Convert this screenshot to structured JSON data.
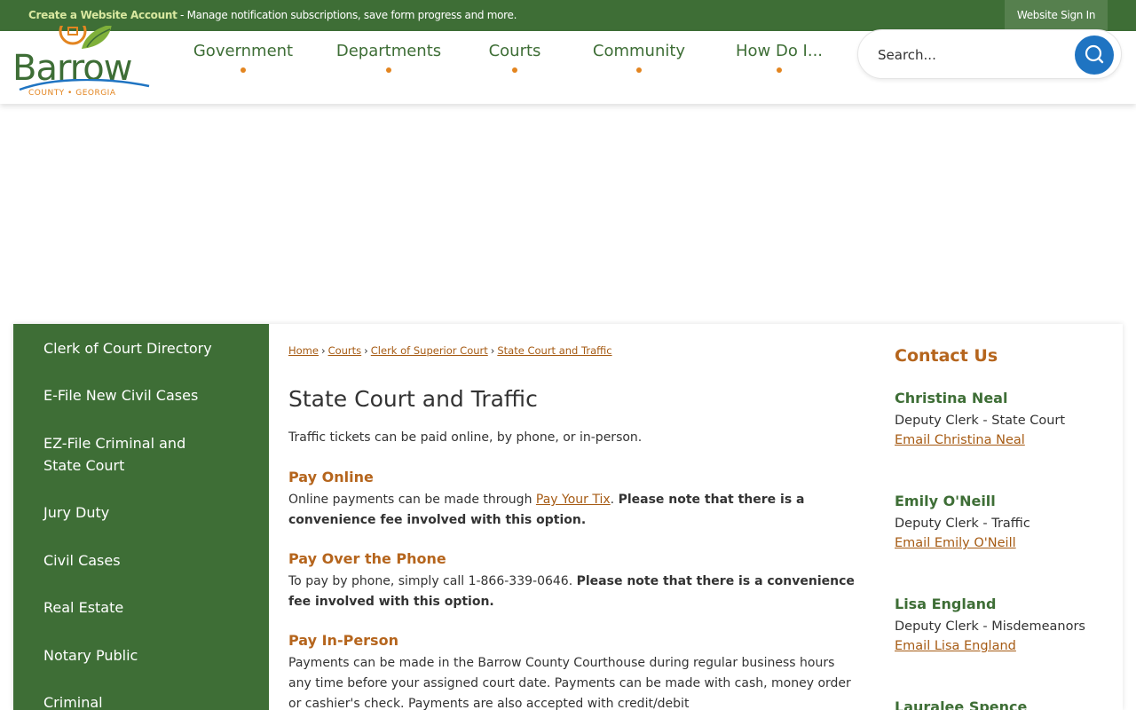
{
  "topbar": {
    "create_link": "Create a Website Account",
    "message": " - Manage notification subscriptions, save form progress and more.",
    "signin": "Website Sign In"
  },
  "logo": {
    "word": "Barrow",
    "sub": "COUNTY • GEORGIA"
  },
  "nav": [
    "Government",
    "Departments",
    "Courts",
    "Community",
    "How Do I..."
  ],
  "search": {
    "placeholder": "Search..."
  },
  "sidebar": {
    "items": [
      "Clerk of Court Directory",
      "E-File New Civil Cases",
      "EZ-File Criminal and State Court",
      "Jury Duty",
      "Civil Cases",
      "Real Estate",
      "Notary Public",
      "Criminal"
    ]
  },
  "breadcrumb": [
    "Home",
    "Courts",
    "Clerk of Superior Court",
    "State Court and Traffic"
  ],
  "page": {
    "title": "State Court and Traffic",
    "intro": "Traffic tickets can be paid online, by phone, or in-person."
  },
  "sections": {
    "online": {
      "heading": "Pay Online",
      "text_before": "Online payments can be made through ",
      "link": "Pay Your Tix",
      "text_after": ". ",
      "note": "Please note that there is a convenience fee involved with this option."
    },
    "phone": {
      "heading": "Pay Over the Phone",
      "text": "To pay by phone, simply call 1-866-339-0646. ",
      "note": "Please note that there is a convenience fee involved with this option."
    },
    "inperson": {
      "heading": "Pay In-Person",
      "text": "Payments can be made in the Barrow County Courthouse during regular business hours any time before your assigned court date. Payments can be made with cash, money order or cashier's check. Payments are also accepted with credit/debit"
    }
  },
  "contact": {
    "heading": "Contact Us",
    "people": [
      {
        "name": "Christina Neal",
        "title": "Deputy Clerk - State Court",
        "email": "Email Christina Neal"
      },
      {
        "name": "Emily O'Neill",
        "title": "Deputy Clerk - Traffic",
        "email": "Email Emily O'Neill"
      },
      {
        "name": "Lisa England",
        "title": "Deputy Clerk - Misdemeanors",
        "email": "Email Lisa England"
      },
      {
        "name": "Lauralee Spence"
      }
    ]
  },
  "colors": {
    "brand_green": "#3e6e36",
    "accent_orange": "#b5651d",
    "link_brown": "#a65b14",
    "search_blue": "#1f74c2"
  }
}
